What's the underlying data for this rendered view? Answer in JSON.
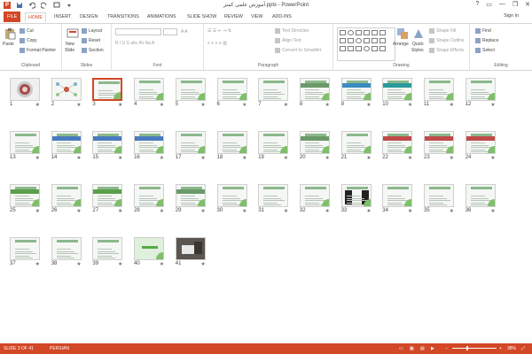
{
  "window": {
    "title": "آموزش علمی کمتر.pptx - PowerPoint",
    "controls": [
      "?",
      "—",
      "❐",
      "✕"
    ]
  },
  "tabs": [
    {
      "label": "FILE",
      "kind": "file"
    },
    {
      "label": "HOME",
      "kind": "active"
    },
    {
      "label": "INSERT"
    },
    {
      "label": "DESIGN"
    },
    {
      "label": "TRANSITIONS"
    },
    {
      "label": "ANIMATIONS"
    },
    {
      "label": "SLIDE SHOW"
    },
    {
      "label": "REVIEW"
    },
    {
      "label": "VIEW"
    },
    {
      "label": "ADD-INS"
    }
  ],
  "signin": "Sign in",
  "ribbon": {
    "clipboard": {
      "paste": "Paste",
      "cut": "Cut",
      "copy": "Copy",
      "format_painter": "Format Painter",
      "label": "Clipboard"
    },
    "slides": {
      "new_slide": "New",
      "new_slide_2": "Slide",
      "layout": "Layout",
      "reset": "Reset",
      "section": "Section",
      "label": "Slides"
    },
    "font": {
      "label": "Font"
    },
    "paragraph": {
      "text_direction": "Text Direction",
      "align_text": "Align Text",
      "convert": "Convert to SmartArt",
      "label": "Paragraph"
    },
    "drawing": {
      "arrange": "Arrange",
      "quick": "Quick",
      "styles": "Styles",
      "shape_fill": "Shape Fill",
      "shape_outline": "Shape Outline",
      "shape_effects": "Shape Effects",
      "label": "Drawing"
    },
    "editing": {
      "find": "Find",
      "replace": "Replace",
      "select": "Select",
      "label": "Editing"
    }
  },
  "slides": [
    {
      "n": "1",
      "style": "title"
    },
    {
      "n": "2",
      "style": "mind"
    },
    {
      "n": "3",
      "style": "plain",
      "selected": true
    },
    {
      "n": "4",
      "style": "plain"
    },
    {
      "n": "5",
      "style": "plain"
    },
    {
      "n": "6",
      "style": "plain"
    },
    {
      "n": "7",
      "style": "blank"
    },
    {
      "n": "8",
      "style": "table"
    },
    {
      "n": "9",
      "style": "blue"
    },
    {
      "n": "10",
      "style": "teal"
    },
    {
      "n": "11",
      "style": "plain"
    },
    {
      "n": "12",
      "style": "plain"
    },
    {
      "n": "13",
      "style": "plain"
    },
    {
      "n": "14",
      "style": "bluetable"
    },
    {
      "n": "15",
      "style": "bluetable"
    },
    {
      "n": "16",
      "style": "bluetable"
    },
    {
      "n": "17",
      "style": "plain"
    },
    {
      "n": "18",
      "style": "plain"
    },
    {
      "n": "19",
      "style": "plain"
    },
    {
      "n": "20",
      "style": "table"
    },
    {
      "n": "21",
      "style": "plain"
    },
    {
      "n": "22",
      "style": "redtable"
    },
    {
      "n": "23",
      "style": "redtable"
    },
    {
      "n": "24",
      "style": "red"
    },
    {
      "n": "25",
      "style": "greentable"
    },
    {
      "n": "26",
      "style": "plain"
    },
    {
      "n": "27",
      "style": "green"
    },
    {
      "n": "28",
      "style": "plain"
    },
    {
      "n": "29",
      "style": "table"
    },
    {
      "n": "30",
      "style": "plain"
    },
    {
      "n": "31",
      "style": "blank"
    },
    {
      "n": "32",
      "style": "plain"
    },
    {
      "n": "33",
      "style": "dark"
    },
    {
      "n": "34",
      "style": "plain"
    },
    {
      "n": "35",
      "style": "blank"
    },
    {
      "n": "36",
      "style": "plain"
    },
    {
      "n": "37",
      "style": "blank"
    },
    {
      "n": "38",
      "style": "blank"
    },
    {
      "n": "39",
      "style": "blank"
    },
    {
      "n": "40",
      "style": "end"
    },
    {
      "n": "41",
      "style": "photo"
    }
  ],
  "statusbar": {
    "slide_info": "SLIDE 3 OF 41",
    "language": "PERSIAN",
    "zoom": "38%"
  },
  "colors": {
    "accent": "#d24726",
    "selected_border": "#d24726"
  }
}
